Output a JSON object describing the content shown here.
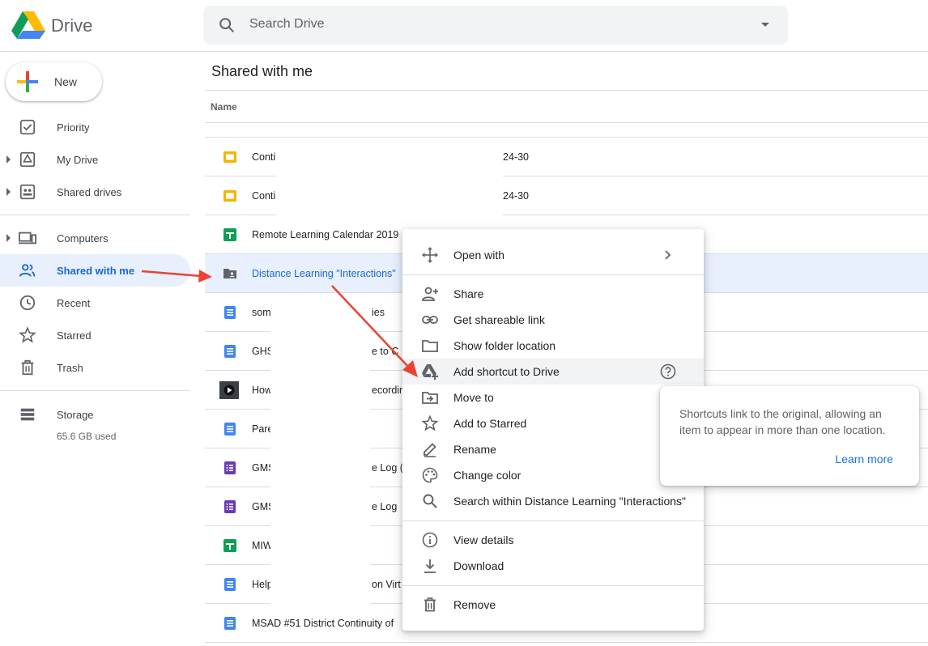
{
  "header": {
    "brand": "Drive",
    "search_placeholder": "Search Drive"
  },
  "sidebar": {
    "new_label": "New",
    "items": [
      {
        "label": "Priority",
        "icon": "priority-icon"
      },
      {
        "label": "My Drive",
        "icon": "my-drive-icon"
      },
      {
        "label": "Shared drives",
        "icon": "shared-drives-icon"
      },
      {
        "label": "Computers",
        "icon": "computers-icon"
      },
      {
        "label": "Shared with me",
        "icon": "shared-with-me-icon",
        "active": true
      },
      {
        "label": "Recent",
        "icon": "clock-icon"
      },
      {
        "label": "Starred",
        "icon": "star-icon"
      },
      {
        "label": "Trash",
        "icon": "trash-icon"
      }
    ],
    "storage_label": "Storage",
    "storage_used": "65.6 GB used"
  },
  "main": {
    "title": "Shared with me",
    "column_name": "Name",
    "rows": [
      {
        "name": "Conti",
        "rest": "24-30",
        "type": "slides"
      },
      {
        "name": "Conti",
        "rest": "24-30",
        "type": "slides"
      },
      {
        "name": "Remote Learning Calendar 2019",
        "rest": "",
        "type": "sheets"
      },
      {
        "name": "Distance Learning \"Interactions\"",
        "rest": "",
        "type": "shared-folder",
        "selected": true
      },
      {
        "name": "som",
        "rest": "ies",
        "type": "docs"
      },
      {
        "name": "GHS",
        "rest": "e to C",
        "type": "docs"
      },
      {
        "name": "How",
        "rest": "ecordin",
        "type": "video"
      },
      {
        "name": "Pare",
        "rest": "",
        "type": "docs"
      },
      {
        "name": "GMS",
        "rest": "e Log (",
        "type": "forms"
      },
      {
        "name": "GMS",
        "rest": "e Log",
        "type": "forms"
      },
      {
        "name": "MIW",
        "rest": "",
        "type": "sheets"
      },
      {
        "name": "Help",
        "rest": "on Virt",
        "type": "docs"
      },
      {
        "name": "MSAD #51 District Continuity of",
        "rest": "",
        "type": "docs"
      }
    ]
  },
  "context_menu": {
    "items": [
      {
        "label": "Open with",
        "icon": "open-with-icon"
      },
      {
        "label": "Share",
        "icon": "add-person-icon"
      },
      {
        "label": "Get shareable link",
        "icon": "link-icon"
      },
      {
        "label": "Show folder location",
        "icon": "folder-icon"
      },
      {
        "label": "Add shortcut to Drive",
        "icon": "add-shortcut-icon"
      },
      {
        "label": "Move to",
        "icon": "move-to-icon"
      },
      {
        "label": "Add to Starred",
        "icon": "star-outline-icon"
      },
      {
        "label": "Rename",
        "icon": "pencil-icon"
      },
      {
        "label": "Change color",
        "icon": "palette-icon"
      },
      {
        "label": "Search within Distance Learning \"Interactions\"",
        "icon": "search-icon"
      },
      {
        "label": "View details",
        "icon": "info-icon"
      },
      {
        "label": "Download",
        "icon": "download-icon"
      },
      {
        "label": "Remove",
        "icon": "trash-icon"
      }
    ]
  },
  "tooltip": {
    "text": "Shortcuts link to the original, allowing an item to appear in more than one location.",
    "link": "Learn more"
  },
  "colors": {
    "accent": "#1a73e8",
    "active_bg": "#e8f0fe",
    "annotation_arrow": "#ea4335"
  }
}
